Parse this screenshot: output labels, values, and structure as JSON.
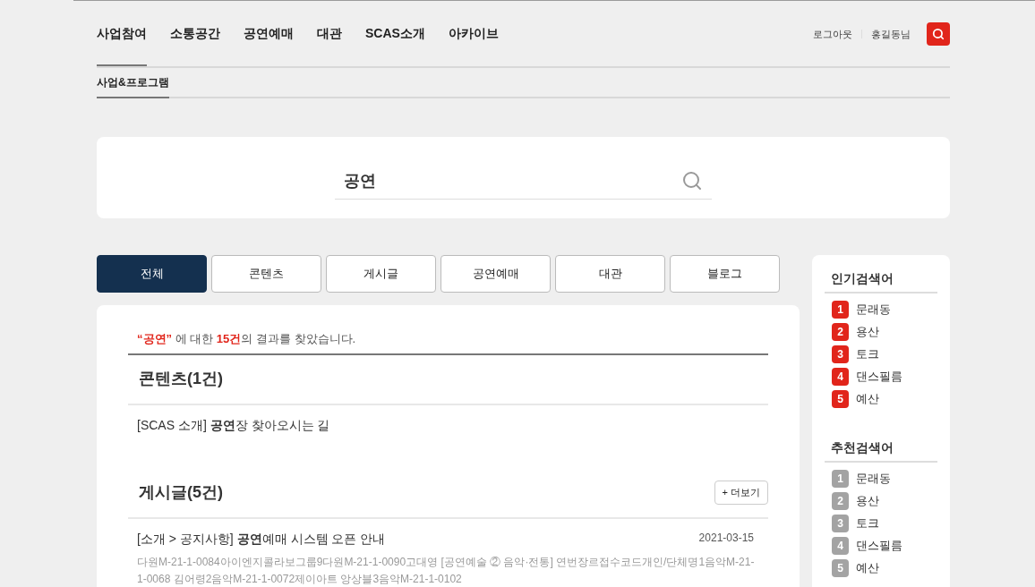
{
  "nav": {
    "items": [
      {
        "label": "사업참여",
        "selected": true
      },
      {
        "label": "소통공간",
        "selected": false
      },
      {
        "label": "공연예매",
        "selected": false
      },
      {
        "label": "대관",
        "selected": false
      },
      {
        "label": "SCAS소개",
        "selected": false
      },
      {
        "label": "아카이브",
        "selected": false
      }
    ],
    "logout": "로그아웃",
    "user": "홍길동님"
  },
  "subnav": {
    "items": [
      {
        "label": "사업&프로그램",
        "selected": true
      }
    ]
  },
  "search": {
    "value": "공연"
  },
  "tabs": [
    {
      "label": "전체",
      "selected": true
    },
    {
      "label": "콘텐츠",
      "selected": false
    },
    {
      "label": "게시글",
      "selected": false
    },
    {
      "label": "공연예매",
      "selected": false
    },
    {
      "label": "대관",
      "selected": false
    },
    {
      "label": "블로그",
      "selected": false
    }
  ],
  "summary": "**“공연”** 에 대한 **15건**의 결과를 찾았습니다.",
  "sections": [
    {
      "title": "콘텐츠(1건)",
      "items": [
        {
          "title": "[SCAS 소개] **공연**장 찾아오시는 길"
        }
      ]
    },
    {
      "title": "게시글(5건)",
      "more": "+ 더보기",
      "items": [
        {
          "title": "[소개 > 공지사항] **공연**예매 시스템 오픈 안내",
          "date": "2021-03-15",
          "excerpt": "다원M-21-1-0084아이엔지콜라보그룹9다원M-21-1-0090고대영 [공연예술 ② 음악·전통] 연번장르접수코드개인/단체명1음악M-21-1-0068 김어령2음악M-21-1-0072제이아트 앙상블3음악M-21-1-0102"
        }
      ]
    }
  ],
  "sidebar": [
    {
      "title": "인기검색어",
      "kind": "popular",
      "items": [
        {
          "rank": "1",
          "label": "문래동"
        },
        {
          "rank": "2",
          "label": "용산"
        },
        {
          "rank": "3",
          "label": "토크"
        },
        {
          "rank": "4",
          "label": "댄스필름"
        },
        {
          "rank": "5",
          "label": "예산"
        }
      ]
    },
    {
      "title": "추천검색어",
      "kind": "recommended",
      "items": [
        {
          "rank": "1",
          "label": "문래동"
        },
        {
          "rank": "2",
          "label": "용산"
        },
        {
          "rank": "3",
          "label": "토크"
        },
        {
          "rank": "4",
          "label": "댄스필름"
        },
        {
          "rank": "5",
          "label": "예산"
        }
      ]
    }
  ]
}
